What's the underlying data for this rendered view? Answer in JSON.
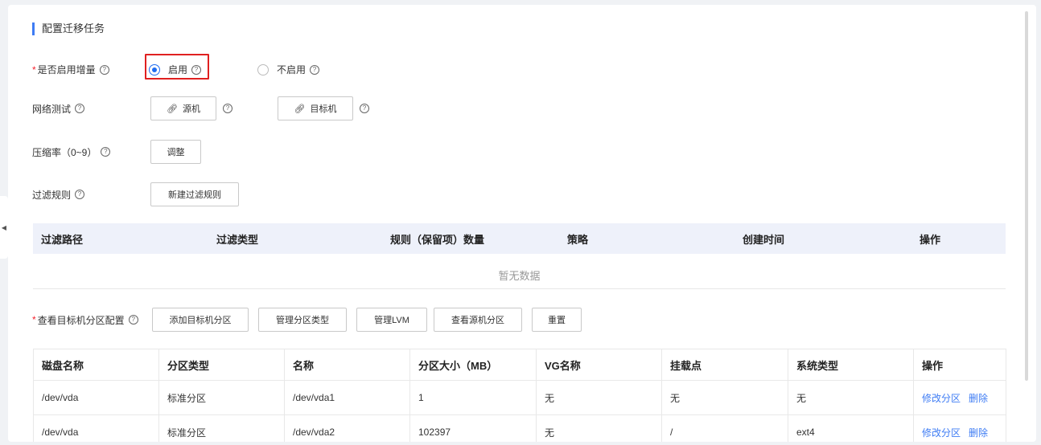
{
  "section_title": "配置迁移任务",
  "incremental": {
    "label": "是否启用增量",
    "options": [
      {
        "label": "启用",
        "checked": true
      },
      {
        "label": "不启用",
        "checked": false
      }
    ]
  },
  "network_test": {
    "label": "网络测试",
    "source_btn": "源机",
    "target_btn": "目标机"
  },
  "compression": {
    "label": "压缩率（0~9）",
    "adjust_btn": "调整"
  },
  "filter_rules": {
    "label": "过滤规则",
    "new_btn": "新建过滤规则",
    "columns": [
      "过滤路径",
      "过滤类型",
      "规则（保留项）数量",
      "策略",
      "创建时间",
      "操作"
    ],
    "empty_text": "暂无数据"
  },
  "partition": {
    "label": "查看目标机分区配置",
    "buttons": {
      "add": "添加目标机分区",
      "manage_types": "管理分区类型",
      "manage_lvm": "管理LVM",
      "view_source": "查看源机分区",
      "reset": "重置"
    },
    "columns": [
      "磁盘名称",
      "分区类型",
      "名称",
      "分区大小（MB）",
      "VG名称",
      "挂载点",
      "系统类型",
      "操作"
    ],
    "rows": [
      {
        "disk": "/dev/vda",
        "type": "标准分区",
        "name": "/dev/vda1",
        "size": "1",
        "vg": "无",
        "mount": "无",
        "fs": "无",
        "edit": "修改分区",
        "delete": "删除"
      },
      {
        "disk": "/dev/vda",
        "type": "标准分区",
        "name": "/dev/vda2",
        "size": "102397",
        "vg": "无",
        "mount": "/",
        "fs": "ext4",
        "edit": "修改分区",
        "delete": "删除"
      }
    ]
  },
  "colors": {
    "accent": "#1f6cf0",
    "required": "#f5222d",
    "highlight": "#e02020",
    "link": "#3e7cf4"
  }
}
